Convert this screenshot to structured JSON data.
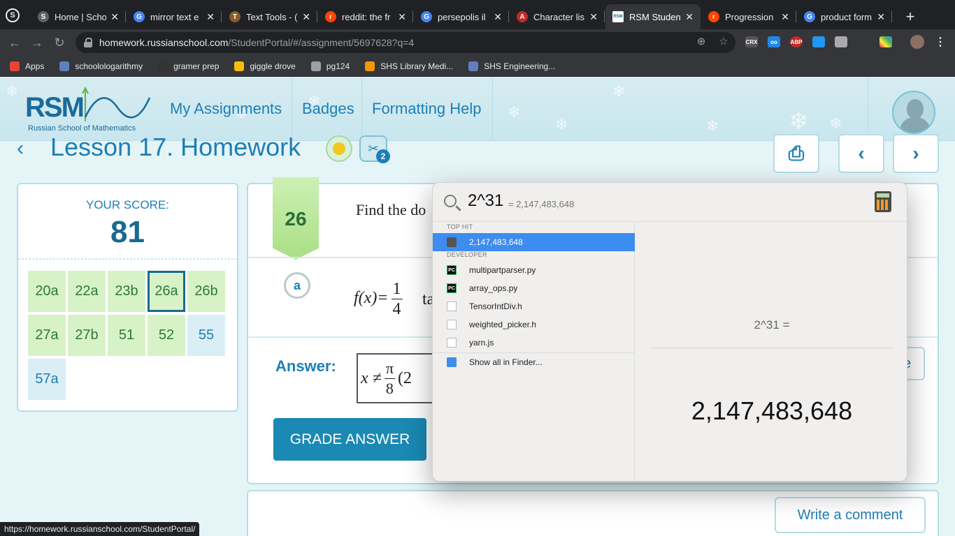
{
  "browser": {
    "tabs": [
      {
        "title": "Home | Scho",
        "favicon": "S",
        "color": "#5f6368"
      },
      {
        "title": "mirror text e",
        "favicon": "G",
        "color": "#4285f4"
      },
      {
        "title": "Text Tools - (",
        "favicon": "T",
        "color": "#8b5a2b"
      },
      {
        "title": "reddit: the fr",
        "favicon": "r",
        "color": "#ff4500"
      },
      {
        "title": "persepolis il",
        "favicon": "G",
        "color": "#4285f4"
      },
      {
        "title": "Character lis",
        "favicon": "A",
        "color": "#c62828"
      },
      {
        "title": "RSM Student",
        "favicon": "RSM",
        "color": "#ffffff",
        "active": true
      },
      {
        "title": "Progression",
        "favicon": "r",
        "color": "#ff4500"
      },
      {
        "title": "product form",
        "favicon": "G",
        "color": "#4285f4"
      }
    ],
    "new_tab": "+",
    "url_host": "homework.russianschool.com",
    "url_path": "/StudentPortal/#/assignment/5697628?q=4",
    "extensions": [
      "CRX",
      "oo",
      "ABP"
    ],
    "bookmarks": [
      {
        "label": "Apps",
        "icon": "apps-grid-icon",
        "color": "#ea4335"
      },
      {
        "label": "schoolologarithmy",
        "icon": "schoology-icon",
        "color": "#5f7fbf"
      },
      {
        "label": "gramer prep",
        "icon": "gb-icon",
        "color": "#333333"
      },
      {
        "label": "giggle drove",
        "icon": "drive-icon",
        "color": "#fbbc04"
      },
      {
        "label": "pg124",
        "icon": "globe-icon",
        "color": "#9aa0a6"
      },
      {
        "label": "SHS Library Medi...",
        "icon": "library-icon",
        "color": "#f29900"
      },
      {
        "label": "SHS Engineering...",
        "icon": "schoology-icon",
        "color": "#5f7fbf"
      }
    ],
    "status_url": "https://homework.russianschool.com/StudentPortal/"
  },
  "rsm": {
    "logo_text": "RSM",
    "logo_subtitle": "Russian School of Mathematics",
    "nav": [
      "My Assignments",
      "Badges",
      "Formatting Help"
    ],
    "lesson_title": "Lesson 17. Homework",
    "badge_count": "2",
    "score_label": "YOUR SCORE:",
    "score_value": "81",
    "questions": [
      {
        "label": "20a",
        "state": "green"
      },
      {
        "label": "22a",
        "state": "green"
      },
      {
        "label": "23b",
        "state": "green"
      },
      {
        "label": "26a",
        "state": "current"
      },
      {
        "label": "26b",
        "state": "green"
      },
      {
        "label": "27a",
        "state": "green"
      },
      {
        "label": "27b",
        "state": "green"
      },
      {
        "label": "51",
        "state": "green"
      },
      {
        "label": "52",
        "state": "green"
      },
      {
        "label": "55",
        "state": "blue"
      },
      {
        "label": "57a",
        "state": "blue"
      }
    ],
    "problem_number": "26",
    "problem_text": "Find the do",
    "part_label": "a",
    "function_lhs": "f(x)=",
    "function_num": "1",
    "function_den": "4",
    "function_rest": "ta",
    "see_button": "e",
    "answer_label": "Answer:",
    "answer_prefix": "x ≠",
    "answer_num": "π",
    "answer_den": "8",
    "answer_rest": "(2",
    "grade_button": "GRADE ANSWER",
    "comment_button": "Write a comment"
  },
  "spotlight": {
    "query": "2^31",
    "inline_result": "= 2,147,483,648",
    "sections": [
      {
        "header": "TOP HIT",
        "items": [
          {
            "label": "2,147,483,648",
            "icon": "calculator-icon",
            "selected": true
          }
        ]
      },
      {
        "header": "DEVELOPER",
        "items": [
          {
            "label": "multipartparser.py",
            "icon": "pycharm-icon"
          },
          {
            "label": "array_ops.py",
            "icon": "pycharm-icon"
          },
          {
            "label": "TensorIntDiv.h",
            "icon": "file-icon"
          },
          {
            "label": "weighted_picker.h",
            "icon": "file-icon"
          },
          {
            "label": "yarn.js",
            "icon": "file-icon"
          }
        ]
      }
    ],
    "show_all": "Show all in Finder...",
    "preview_expression": "2^31 =",
    "preview_result": "2,147,483,648"
  }
}
